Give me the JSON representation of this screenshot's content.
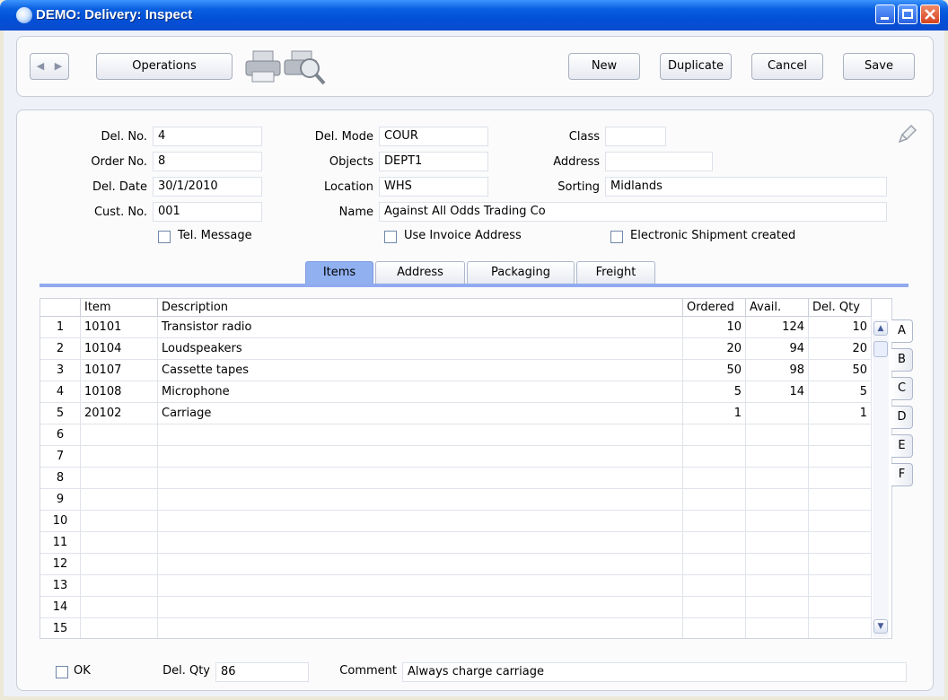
{
  "window": {
    "title": "DEMO: Delivery: Inspect"
  },
  "toolbar": {
    "operations_label": "Operations",
    "new_label": "New",
    "duplicate_label": "Duplicate",
    "cancel_label": "Cancel",
    "save_label": "Save"
  },
  "header": {
    "del_no_label": "Del. No.",
    "del_no": "4",
    "order_no_label": "Order No.",
    "order_no": "8",
    "del_date_label": "Del. Date",
    "del_date": "30/1/2010",
    "cust_no_label": "Cust. No.",
    "cust_no": "001",
    "del_mode_label": "Del. Mode",
    "del_mode": "COUR",
    "objects_label": "Objects",
    "objects": "DEPT1",
    "location_label": "Location",
    "location": "WHS",
    "name_label": "Name",
    "name": "Against All Odds Trading Co",
    "class_label": "Class",
    "class": "",
    "address_label": "Address",
    "address": "",
    "sorting_label": "Sorting",
    "sorting": "Midlands",
    "tel_message_label": "Tel. Message",
    "use_invoice_address_label": "Use Invoice Address",
    "electronic_shipment_label": "Electronic Shipment created"
  },
  "tabs": [
    "Items",
    "Address",
    "Packaging",
    "Freight"
  ],
  "active_tab": "Items",
  "grid": {
    "columns": [
      "Item",
      "Description",
      "Ordered",
      "Avail.",
      "Del. Qty"
    ],
    "rows": [
      {
        "n": "1",
        "item": "10101",
        "description": "Transistor radio",
        "ordered": "10",
        "avail": "124",
        "del_qty": "10"
      },
      {
        "n": "2",
        "item": "10104",
        "description": "Loudspeakers",
        "ordered": "20",
        "avail": "94",
        "del_qty": "20"
      },
      {
        "n": "3",
        "item": "10107",
        "description": "Cassette tapes",
        "ordered": "50",
        "avail": "98",
        "del_qty": "50"
      },
      {
        "n": "4",
        "item": "10108",
        "description": "Microphone",
        "ordered": "5",
        "avail": "14",
        "del_qty": "5"
      },
      {
        "n": "5",
        "item": "20102",
        "description": "Carriage",
        "ordered": "1",
        "avail": "",
        "del_qty": "1"
      },
      {
        "n": "6",
        "item": "",
        "description": "",
        "ordered": "",
        "avail": "",
        "del_qty": ""
      },
      {
        "n": "7",
        "item": "",
        "description": "",
        "ordered": "",
        "avail": "",
        "del_qty": ""
      },
      {
        "n": "8",
        "item": "",
        "description": "",
        "ordered": "",
        "avail": "",
        "del_qty": ""
      },
      {
        "n": "9",
        "item": "",
        "description": "",
        "ordered": "",
        "avail": "",
        "del_qty": ""
      },
      {
        "n": "10",
        "item": "",
        "description": "",
        "ordered": "",
        "avail": "",
        "del_qty": ""
      },
      {
        "n": "11",
        "item": "",
        "description": "",
        "ordered": "",
        "avail": "",
        "del_qty": ""
      },
      {
        "n": "12",
        "item": "",
        "description": "",
        "ordered": "",
        "avail": "",
        "del_qty": ""
      },
      {
        "n": "13",
        "item": "",
        "description": "",
        "ordered": "",
        "avail": "",
        "del_qty": ""
      },
      {
        "n": "14",
        "item": "",
        "description": "",
        "ordered": "",
        "avail": "",
        "del_qty": ""
      },
      {
        "n": "15",
        "item": "",
        "description": "",
        "ordered": "",
        "avail": "",
        "del_qty": ""
      }
    ]
  },
  "side_tabs": [
    "A",
    "B",
    "C",
    "D",
    "E",
    "F"
  ],
  "active_side_tab": "A",
  "footer": {
    "ok_label": "OK",
    "del_qty_label": "Del. Qty",
    "del_qty": "86",
    "comment_label": "Comment",
    "comment": "Always charge carriage"
  },
  "icons": {
    "app": "app-icon",
    "print": "printer-icon",
    "preview": "print-preview-icon",
    "edit": "pencil-icon",
    "prev": "back-arrow-icon",
    "next": "forward-arrow-icon"
  }
}
